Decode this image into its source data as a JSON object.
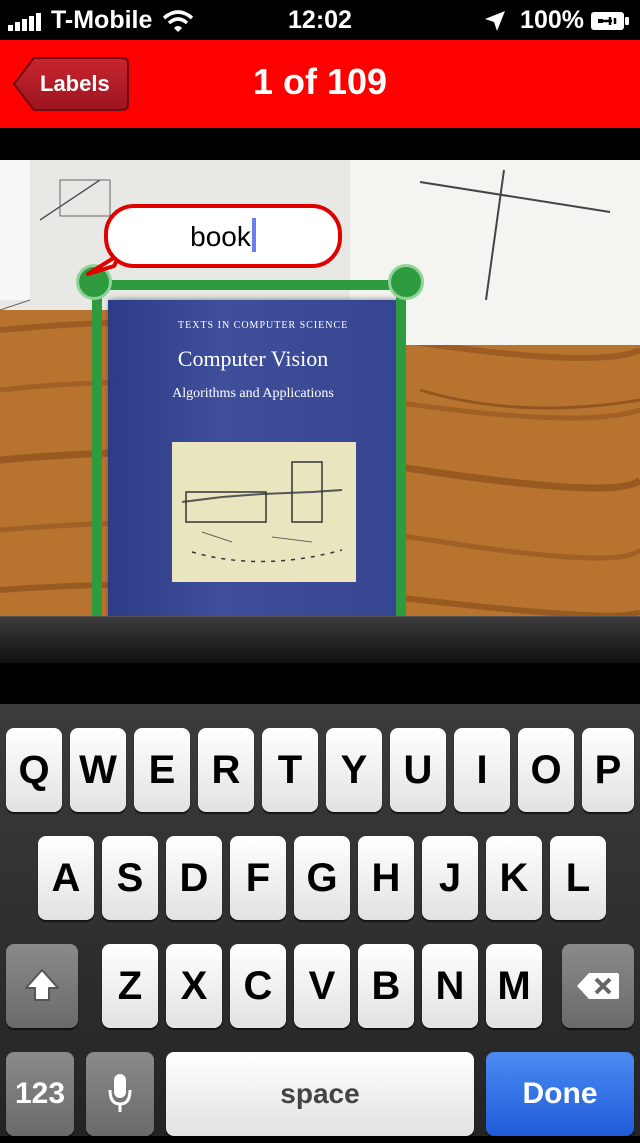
{
  "status_bar": {
    "carrier": "T-Mobile",
    "time": "12:02",
    "battery": "100%"
  },
  "nav": {
    "back_label": "Labels",
    "title": "1 of 109"
  },
  "photo": {
    "book": {
      "series": "TEXTS IN COMPUTER SCIENCE",
      "title": "Computer Vision",
      "subtitle": "Algorithms and Applications"
    }
  },
  "label_editor": {
    "value": "book"
  },
  "keyboard": {
    "row1": [
      "Q",
      "W",
      "E",
      "R",
      "T",
      "Y",
      "U",
      "I",
      "O",
      "P"
    ],
    "row2": [
      "A",
      "S",
      "D",
      "F",
      "G",
      "H",
      "J",
      "K",
      "L"
    ],
    "row3": [
      "Z",
      "X",
      "C",
      "V",
      "B",
      "N",
      "M"
    ],
    "numbers_label": "123",
    "space_label": "space",
    "done_label": "Done"
  },
  "colors": {
    "nav_bar": "#ff0000",
    "box": "#2e9c3e",
    "done_key": "#2f6fe6"
  }
}
